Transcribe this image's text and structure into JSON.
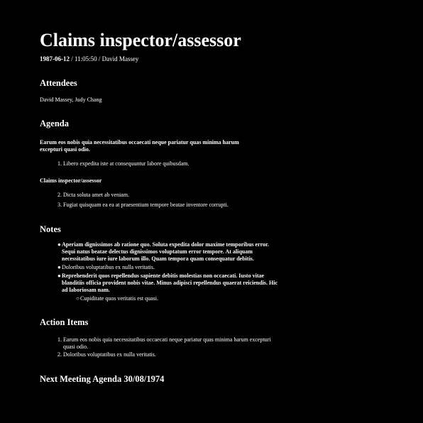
{
  "title": "Claims inspector/assessor",
  "meta": {
    "date": "1987-06-12",
    "rest": " / 11:05:50 / David Massey"
  },
  "attendees": {
    "heading": "Attendees",
    "names": "David Massey, Judy Chang"
  },
  "agenda": {
    "heading": "Agenda",
    "intro": "Earum eos nobis quia necessitatibus occaecati neque pariatur quas minima harum excepturi quasi odio.",
    "item1": "Libero expedita iste at consequuntur labore quibusdam.",
    "subheading": "Claims inspector/assessor",
    "item2": "Dicta soluta amet ab veniam.",
    "item3": "Fugiat quisquam ea ea at praesentium tempore beatae inventore corrupti."
  },
  "notes": {
    "heading": "Notes",
    "bullet1": "Aperiam dignissimos ab ratione quo. Soluta expedita dolor maxime temporibus error. Sequi natus beatae delectus dignissimos voluptatum error tempore. At aliquam necessitatibus iure iure laborum illo. Quam tempora quam consequatur debitis.",
    "bullet2": "Doloribus voluptatibus ex nulla veritatis.",
    "bullet3": "Reprehenderit quos repellendus sapiente debitis molestias non occaecati. Iusto vitae blanditiis officia provident nobis vitae. Minus adipisci repellendus quaerat reiciendis. Hic ad laboriosam nam.",
    "subbullet": "Cupiditate quos veritatis est quasi."
  },
  "action_items": {
    "heading": "Action Items",
    "item1": "Earum eos nobis quia necessitatibus occaecati neque pariatur quas minima harum excepturi quasi odio.",
    "item2": "Doloribus voluptatibus ex nulla veritatis."
  },
  "next_meeting": {
    "heading": "Next Meeting Agenda 30/08/1974"
  }
}
